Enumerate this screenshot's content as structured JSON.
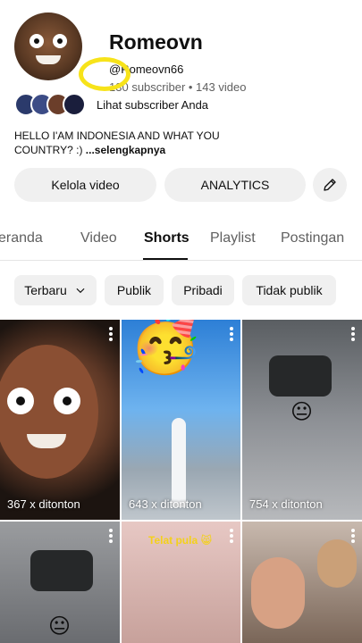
{
  "channel": {
    "name": "Romeovn",
    "handle": "@Romeovn66",
    "subscriber_count": "130",
    "subscriber_suffix": " subscriber • 143 video",
    "see_subscribers": "Lihat subscriber Anda",
    "description_line1": "HELLO I'AM INDONESIA AND WHAT YOU",
    "description_line2": "COUNTRY? :) ",
    "description_more": "...selengkapnya"
  },
  "actions": {
    "manage_videos": "Kelola video",
    "analytics": "ANALYTICS",
    "edit_icon": "pencil-icon"
  },
  "tabs": [
    "eranda",
    "Video",
    "Shorts",
    "Playlist",
    "Postingan"
  ],
  "active_tab": "Shorts",
  "filters": {
    "sort": "Terbaru",
    "chips": [
      "Publik",
      "Pribadi",
      "Tidak publik"
    ]
  },
  "shorts": [
    {
      "views": "367 x ditonton"
    },
    {
      "views": "643 x ditonton"
    },
    {
      "views": "754 x ditonton"
    },
    {
      "caption": "Telat pula 😸"
    }
  ],
  "colors": {
    "highlight_circle": "#f7e31a",
    "chip_bg": "#f0f0f0",
    "text_secondary": "#606060"
  }
}
